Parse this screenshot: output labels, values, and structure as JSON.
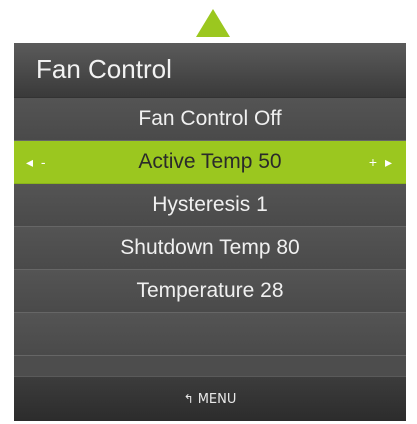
{
  "panel": {
    "title": "Fan Control"
  },
  "menu": {
    "items": [
      {
        "label": "Fan Control Off"
      },
      {
        "label": "Active Temp  50",
        "left_control": "◂ -",
        "right_control": "+ ▸"
      },
      {
        "label": "Hysteresis  1"
      },
      {
        "label": "Shutdown Temp  80"
      },
      {
        "label": "Temperature  28"
      }
    ]
  },
  "footer": {
    "icon": "back-arrow-icon",
    "label": "MENU"
  },
  "colors": {
    "accent": "#9bc71f",
    "panel": "#4f4f4f"
  }
}
